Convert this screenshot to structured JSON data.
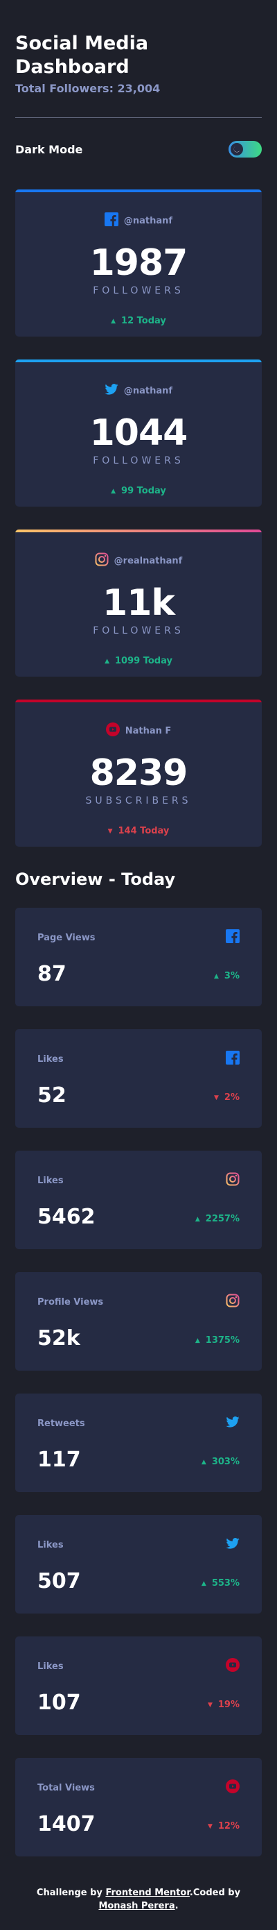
{
  "header": {
    "title": "Social Media Dashboard",
    "total_followers": "Total Followers: 23,004"
  },
  "mode": {
    "label": "Dark Mode",
    "toggle_on": true
  },
  "colors": {
    "facebook": "#1877f2",
    "twitter": "#1da1f2",
    "instagram_start": "#fdc468",
    "instagram_end": "#df4996",
    "youtube": "#c4032a",
    "up": "#1db489",
    "down": "#dc414c"
  },
  "cards": [
    {
      "platform": "facebook",
      "icon": "facebook-icon",
      "handle": "@nathanf",
      "count": "1987",
      "label": "FOLLOWERS",
      "today": "12 Today",
      "trend": "up"
    },
    {
      "platform": "twitter",
      "icon": "twitter-icon",
      "handle": "@nathanf",
      "count": "1044",
      "label": "FOLLOWERS",
      "today": "99 Today",
      "trend": "up"
    },
    {
      "platform": "instagram",
      "icon": "instagram-icon",
      "handle": "@realnathanf",
      "count": "11k",
      "label": "FOLLOWERS",
      "today": "1099 Today",
      "trend": "up"
    },
    {
      "platform": "youtube",
      "icon": "youtube-icon",
      "handle": "Nathan F",
      "count": "8239",
      "label": "SUBSCRIBERS",
      "today": "144 Today",
      "trend": "down"
    }
  ],
  "overview": {
    "title": "Overview - Today",
    "items": [
      {
        "label": "Page Views",
        "icon": "facebook-icon",
        "value": "87",
        "change": "3%",
        "trend": "up"
      },
      {
        "label": "Likes",
        "icon": "facebook-icon",
        "value": "52",
        "change": "2%",
        "trend": "down"
      },
      {
        "label": "Likes",
        "icon": "instagram-icon",
        "value": "5462",
        "change": "2257%",
        "trend": "up"
      },
      {
        "label": "Profile Views",
        "icon": "instagram-icon",
        "value": "52k",
        "change": "1375%",
        "trend": "up"
      },
      {
        "label": "Retweets",
        "icon": "twitter-icon",
        "value": "117",
        "change": "303%",
        "trend": "up"
      },
      {
        "label": "Likes",
        "icon": "twitter-icon",
        "value": "507",
        "change": "553%",
        "trend": "up"
      },
      {
        "label": "Likes",
        "icon": "youtube-icon",
        "value": "107",
        "change": "19%",
        "trend": "down"
      },
      {
        "label": "Total Views",
        "icon": "youtube-icon",
        "value": "1407",
        "change": "12%",
        "trend": "down"
      }
    ]
  },
  "footer": {
    "prefix": "Challenge by ",
    "link1": "Frontend Mentor",
    "middle": ".Coded by ",
    "link2": "Monash Perera",
    "suffix": "."
  }
}
